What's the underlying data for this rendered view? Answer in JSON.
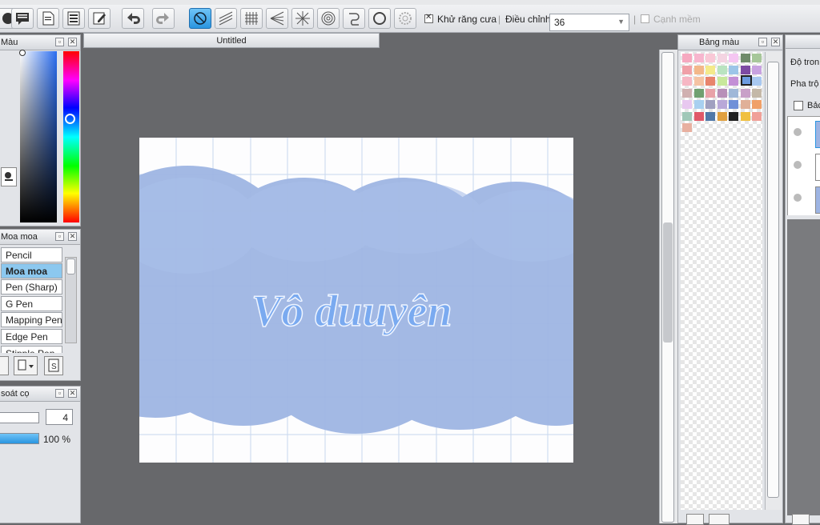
{
  "toolbar": {
    "antialias_label": "Khử răng cưa",
    "antialias_checked": true,
    "adjust_label": "Điều chỉnh",
    "adjust_value": "36",
    "smooth_label": "Cạnh mềm",
    "smooth_checked": false
  },
  "panels": {
    "color_title": "Màu",
    "brush_title": "Moa moa",
    "brush_control_title": "soát cọ",
    "palette_title": "Bảng màu",
    "layer_blend_label": "Độ tron",
    "layer_mix_label": "Pha trộ",
    "layer_check_label": "Bảc"
  },
  "document": {
    "tab_title": "Untitled",
    "canvas_text": "Vô duuyên"
  },
  "brushes": [
    {
      "label": "Pencil",
      "selected": false
    },
    {
      "label": "Moa moa",
      "selected": true
    },
    {
      "label": "Pen (Sharp)",
      "selected": false
    },
    {
      "label": "G Pen",
      "selected": false
    },
    {
      "label": "Mapping Pen",
      "selected": false
    },
    {
      "label": "Edge Pen",
      "selected": false
    },
    {
      "label": "Stipple Pen",
      "selected": false
    }
  ],
  "brush_control": {
    "size_value": "4",
    "opacity_value": "100 %",
    "opacity": 1.0
  },
  "colors": {
    "canvas_blue": "#9db4e3",
    "text_blue": "#7aaaf0",
    "accent": "#2a95e0",
    "palette": [
      "#f6a9c0",
      "#f7b6ce",
      "#f9c8d6",
      "#f4d4e2",
      "#f5c6f2",
      "#6f8a6a",
      "#a7c79a",
      "#f0a0a8",
      "#f3b88a",
      "#f4ea8a",
      "#b9e3c0",
      "#9cc5e8",
      "#7d4aa3",
      "#c8a2e0",
      "#f6b7c4",
      "#f5c3a3",
      "#e8846c",
      "#c8e89c",
      "#c38fd6",
      "#6c9be0",
      "#a8c8f0",
      "#d0b0b0",
      "#70a070",
      "#e8a2a8",
      "#b890b8",
      "#a0b8d8",
      "#c8a0c8",
      "#c4b8a8",
      "#e8c8f0",
      "#a8d0f0",
      "#a0a0c0",
      "#b8a8d8",
      "#7090d8",
      "#e0b098",
      "#f0a068",
      "#a0c8b8",
      "#e05868",
      "#5078a8",
      "#e0a040",
      "#202020",
      "#f0c040",
      "#f0a098",
      "#e8b0a0"
    ]
  }
}
